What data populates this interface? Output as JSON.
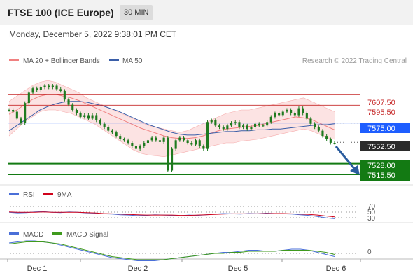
{
  "header": {
    "title": "FTSE 100 (ICE Europe)",
    "timeframe": "30 MIN"
  },
  "timestamp": "Monday, December 5, 2022 9:38:01 PM CET",
  "colors": {
    "candle": "#1f7a1f",
    "ma20": "#f08080",
    "bands_fill": "#fbd9d9",
    "ma50": "#3a5ea8",
    "resistance": "#c62828",
    "level_blue": "#1e5eff",
    "support": "#137a13",
    "arrow": "#2a5c9e",
    "rsi": "#4a6fd8",
    "rsi_9ma": "#d0021b",
    "macd": "#4a6fd8",
    "macd_signal": "#3f9a1d"
  },
  "chart_data": [
    {
      "type": "candlestick",
      "legend": [
        {
          "name": "MA 20 + Bollinger Bands",
          "color": "#f08080"
        },
        {
          "name": "MA 50",
          "color": "#3a5ea8"
        }
      ],
      "copyright": "Research © 2022 Trading Central",
      "x_ticks": [
        "Dec 1",
        "Dec 2",
        "Dec 5",
        "Dec 6"
      ],
      "price_range": [
        7505,
        7620
      ],
      "levels": [
        {
          "label": "7607.50",
          "value": 7607.5,
          "kind": "resistance"
        },
        {
          "label": "7595.50",
          "value": 7595.5,
          "kind": "resistance"
        },
        {
          "label": "7575.00",
          "value": 7575.0,
          "kind": "blue"
        },
        {
          "label": "7552.50",
          "value": 7552.5,
          "kind": "last"
        },
        {
          "label": "7528.00",
          "value": 7528.0,
          "kind": "support"
        },
        {
          "label": "7515.50",
          "value": 7515.5,
          "kind": "support"
        }
      ],
      "close_series": [
        7590,
        7588,
        7580,
        7575,
        7598,
        7610,
        7615,
        7613,
        7616,
        7618,
        7616,
        7618,
        7614,
        7612,
        7602,
        7596,
        7590,
        7586,
        7582,
        7584,
        7580,
        7584,
        7578,
        7574,
        7570,
        7566,
        7564,
        7560,
        7556,
        7555,
        7552,
        7548,
        7545,
        7548,
        7552,
        7555,
        7558,
        7555,
        7553,
        7558,
        7520,
        7545,
        7555,
        7558,
        7555,
        7552,
        7550,
        7555,
        7548,
        7545,
        7576,
        7578,
        7572,
        7570,
        7568,
        7572,
        7575,
        7576,
        7570,
        7572,
        7568,
        7570,
        7574,
        7572,
        7572,
        7576,
        7582,
        7586,
        7584,
        7588,
        7590,
        7586,
        7584,
        7592,
        7586,
        7580,
        7574,
        7570,
        7566,
        7560,
        7556,
        7552,
        7552
      ],
      "ma20": [
        7585,
        7590,
        7596,
        7602,
        7606,
        7608,
        7608,
        7606,
        7604,
        7601,
        7597,
        7593,
        7589,
        7585,
        7581,
        7577,
        7573,
        7569,
        7566,
        7563,
        7560,
        7558,
        7557,
        7557,
        7558,
        7560,
        7563,
        7566,
        7568,
        7569,
        7570,
        7571,
        7572,
        7574,
        7576,
        7578,
        7580,
        7582,
        7581,
        7579,
        7575,
        7571,
        7567
      ],
      "bb_upper": [
        7600,
        7606,
        7612,
        7618,
        7622,
        7624,
        7622,
        7618,
        7614,
        7610,
        7604,
        7600,
        7596,
        7592,
        7588,
        7584,
        7580,
        7576,
        7572,
        7570,
        7568,
        7566,
        7564,
        7566,
        7570,
        7574,
        7578,
        7582,
        7586,
        7588,
        7590,
        7590,
        7592,
        7594,
        7596,
        7598,
        7600,
        7602,
        7604,
        7600,
        7596,
        7592,
        7588
      ],
      "bb_lower": [
        7560,
        7568,
        7576,
        7582,
        7588,
        7590,
        7590,
        7588,
        7586,
        7582,
        7578,
        7574,
        7568,
        7562,
        7556,
        7550,
        7544,
        7540,
        7538,
        7537,
        7536,
        7538,
        7540,
        7542,
        7544,
        7546,
        7548,
        7550,
        7552,
        7552,
        7554,
        7555,
        7556,
        7558,
        7560,
        7562,
        7564,
        7566,
        7568,
        7566,
        7562,
        7558,
        7556
      ],
      "ma50": [
        7566,
        7572,
        7578,
        7584,
        7590,
        7594,
        7597,
        7599,
        7600,
        7600,
        7599,
        7597,
        7595,
        7592,
        7589,
        7585,
        7581,
        7577,
        7573,
        7570,
        7567,
        7564,
        7562,
        7561,
        7561,
        7562,
        7563,
        7564,
        7565,
        7565,
        7566,
        7566,
        7567,
        7567,
        7568,
        7568,
        7569,
        7570,
        7571,
        7572,
        7573,
        7573,
        7574
      ]
    },
    {
      "type": "line",
      "legend": [
        {
          "name": "RSI",
          "color": "#4a6fd8"
        },
        {
          "name": "9MA",
          "color": "#d0021b"
        }
      ],
      "y_ticks": [
        "70",
        "50",
        "30"
      ],
      "rsi": [
        52,
        50,
        51,
        53,
        54,
        52,
        51,
        53,
        52,
        50,
        49,
        47,
        46,
        44,
        43,
        41,
        42,
        44,
        43,
        42,
        41,
        43,
        42,
        44,
        46,
        48,
        47,
        46,
        48,
        47,
        49,
        48,
        47,
        46,
        44,
        42,
        38,
        34,
        31
      ],
      "rsi_9ma": [
        53,
        52,
        52,
        52,
        53,
        52,
        52,
        52,
        52,
        51,
        50,
        48,
        47,
        46,
        45,
        44,
        43,
        43,
        43,
        43,
        42,
        42,
        43,
        44,
        45,
        46,
        47,
        47,
        47,
        47,
        48,
        48,
        48,
        47,
        46,
        45,
        43,
        40,
        37
      ]
    },
    {
      "type": "line",
      "legend": [
        {
          "name": "MACD",
          "color": "#4a6fd8"
        },
        {
          "name": "MACD Signal",
          "color": "#3f9a1d"
        }
      ],
      "y_ticks": [
        "0"
      ],
      "macd": [
        10,
        11,
        12,
        12,
        11,
        10,
        8,
        6,
        4,
        2,
        0,
        -2,
        -4,
        -5,
        -6,
        -7,
        -7,
        -7,
        -6,
        -5,
        -4,
        -3,
        -2,
        -1,
        0,
        1,
        1,
        2,
        3,
        3,
        2,
        2,
        3,
        4,
        4,
        3,
        1,
        -1,
        -3
      ],
      "macd_signal": [
        9,
        10,
        11,
        11,
        11,
        10,
        9,
        7,
        5,
        3,
        1,
        -1,
        -3,
        -4,
        -5,
        -6,
        -6,
        -6,
        -6,
        -5,
        -4,
        -3,
        -2,
        -1,
        0,
        0,
        1,
        1,
        2,
        2,
        2,
        2,
        3,
        3,
        3,
        3,
        2,
        1,
        -1
      ]
    }
  ]
}
